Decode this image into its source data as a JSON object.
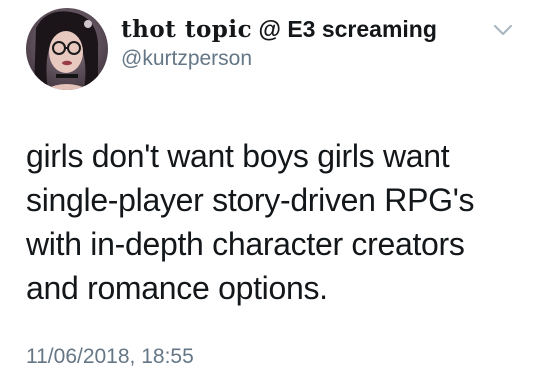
{
  "author": {
    "display_name_stylized": "thot topic",
    "display_name_rest": " @ E3 screaming",
    "handle": "@kurtzperson"
  },
  "tweet": {
    "lines": [
      "girls don't want boys girls want",
      "single-player story-driven RPG's",
      "with in-depth character creators",
      "and romance options."
    ],
    "timestamp": "11/06/2018, 18:55"
  },
  "icons": {
    "menu": "chevron-down-icon"
  },
  "colors": {
    "text_primary": "#14171a",
    "text_secondary": "#657786",
    "chevron": "#aab8c2"
  }
}
